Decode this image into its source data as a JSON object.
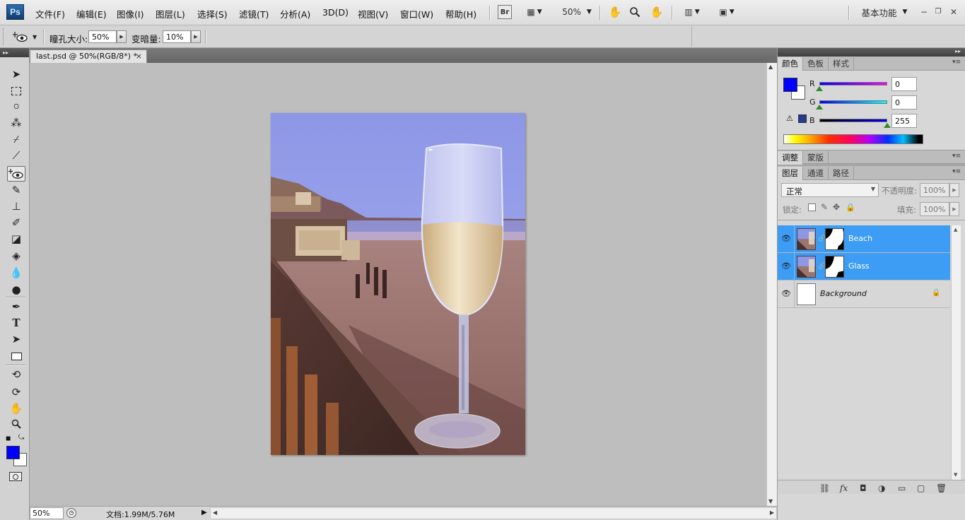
{
  "app": {
    "logo": "Ps",
    "menu": [
      "文件(F)",
      "编辑(E)",
      "图像(I)",
      "图层(L)",
      "选择(S)",
      "滤镜(T)",
      "分析(A)",
      "3D(D)",
      "视图(V)",
      "窗口(W)",
      "帮助(H)"
    ],
    "bridge_label": "Br",
    "zoom_menu": "50%",
    "workspace": "基本功能"
  },
  "options_bar": {
    "pupil_size_label": "瞳孔大小:",
    "pupil_size_value": "50%",
    "darken_label": "变暗量:",
    "darken_value": "10%"
  },
  "document": {
    "tab_title": "last.psd @ 50%(RGB/8*) *",
    "tab_close": "×",
    "status_zoom": "50%",
    "status_info": "文档:1.99M/5.76M"
  },
  "color_panel": {
    "tabs": [
      "颜色",
      "色板",
      "样式"
    ],
    "active_tab": "颜色",
    "foreground": "#0000ff",
    "background": "#ffffff",
    "channels": [
      {
        "label": "R",
        "value": "0",
        "level": 0
      },
      {
        "label": "G",
        "value": "0",
        "level": 0
      },
      {
        "label": "B",
        "value": "255",
        "level": 1
      }
    ],
    "web_safe_swatch": "#233c8c"
  },
  "adjust_panel": {
    "tabs": [
      "调整",
      "蒙版"
    ]
  },
  "layers_panel": {
    "tabs": [
      "图层",
      "通道",
      "路径"
    ],
    "blend_mode": "正常",
    "opacity_label": "不透明度:",
    "opacity_value": "100%",
    "lock_label": "锁定:",
    "fill_label": "填充:",
    "fill_value": "100%",
    "layers": [
      {
        "name": "Beach",
        "selected": true,
        "visible": true
      },
      {
        "name": "Glass",
        "selected": true,
        "visible": true
      },
      {
        "name": "Background",
        "selected": false,
        "visible": true,
        "locked": true
      }
    ],
    "selection_color": "#3d9cf4"
  }
}
